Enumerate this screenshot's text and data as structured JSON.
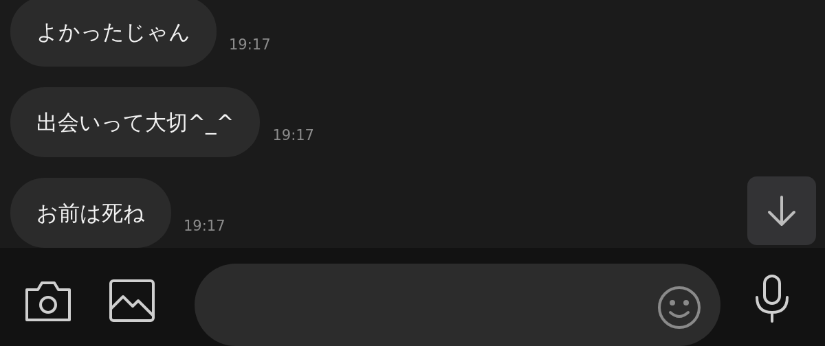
{
  "messages": [
    {
      "text": "よかったじゃん",
      "time": "19:17"
    },
    {
      "text": "出会いって大切^_^",
      "time": "19:17"
    },
    {
      "text": "お前は死ね",
      "time": "19:17"
    }
  ]
}
